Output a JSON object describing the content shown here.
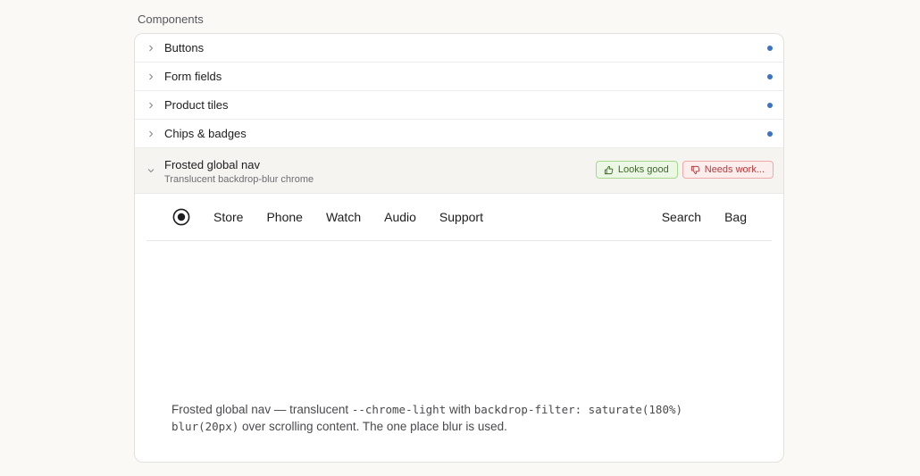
{
  "section": {
    "title": "Components"
  },
  "colors": {
    "dot": "#3b74c4",
    "good": "#3a6b22",
    "needs_work": "#b53a3a"
  },
  "items": [
    {
      "label": "Buttons"
    },
    {
      "label": "Form fields"
    },
    {
      "label": "Product tiles"
    },
    {
      "label": "Chips & badges"
    }
  ],
  "expanded": {
    "label": "Frosted global nav",
    "subtitle": "Translucent backdrop-blur chrome",
    "actions": {
      "good": {
        "label": "Looks good",
        "icon": "thumbs-up-icon"
      },
      "work": {
        "label": "Needs work...",
        "icon": "thumbs-down-icon"
      }
    }
  },
  "preview": {
    "logo_icon": "target-logo-icon",
    "nav_left": [
      "Store",
      "Phone",
      "Watch",
      "Audio",
      "Support"
    ],
    "nav_right": [
      "Search",
      "Bag"
    ],
    "caption": {
      "part1": "Frosted global nav — translucent ",
      "code1": "--chrome-light",
      "part2": " with ",
      "code2": "backdrop-filter: saturate(180%)",
      "part3": " ",
      "code3": "blur(20px)",
      "part4": " over scrolling content. The one place blur is used."
    }
  }
}
